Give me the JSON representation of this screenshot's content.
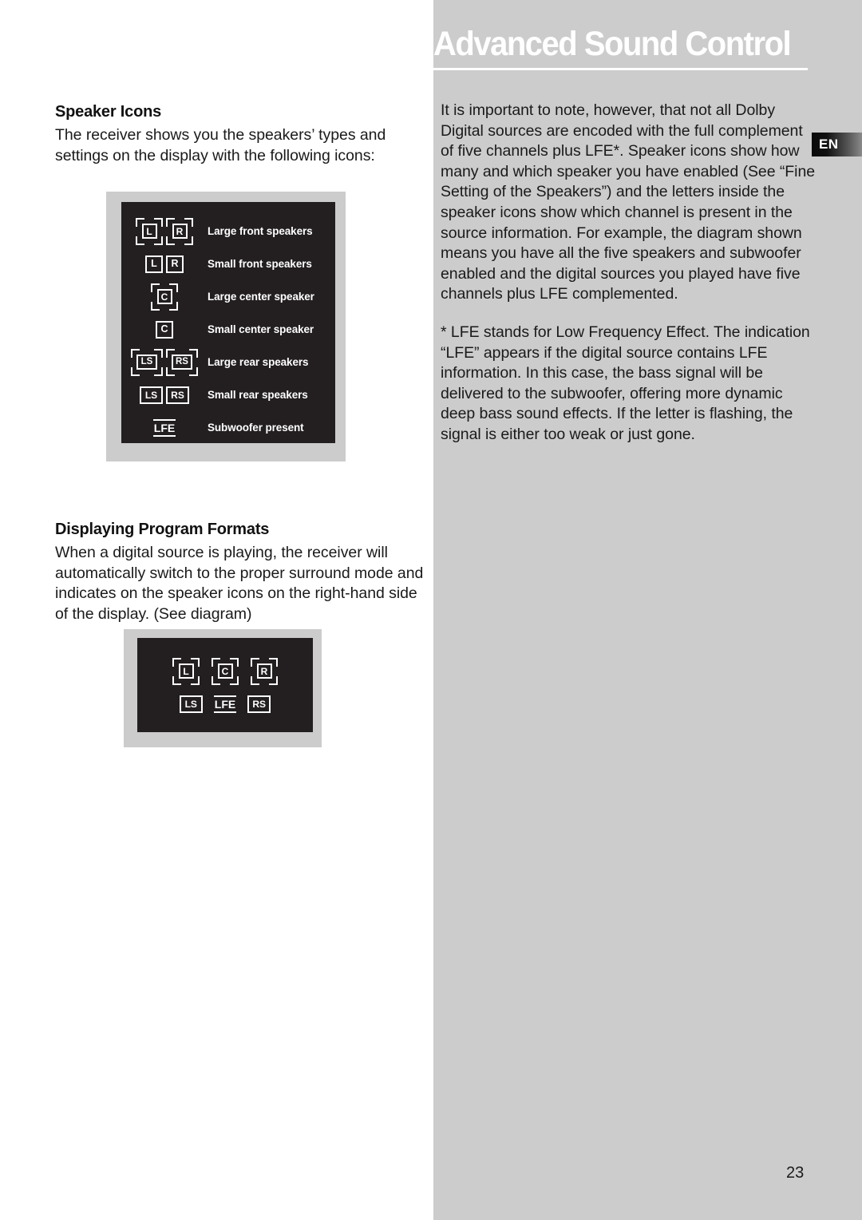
{
  "document": {
    "title": "Advanced Sound Control",
    "language_badge": "EN",
    "page_number": "23"
  },
  "left_column": {
    "sections": [
      {
        "heading": "Speaker Icons",
        "paragraph": "The receiver shows you the speakers’ types and settings on the display with the following icons:"
      },
      {
        "heading": "Displaying Program Formats",
        "paragraph": "When a digital source is playing, the receiver will automatically switch to the proper surround mode and indicates on the speaker icons on the right-hand side of the display. (See diagram)"
      }
    ]
  },
  "right_column": {
    "paragraphs": [
      "It is important to note, however, that not all Dolby Digital sources are encoded with the full complement of five channels plus LFE*. Speaker icons show how many and which speaker you have enabled (See “Fine Setting of the Speakers”) and the letters inside the speaker icons show which channel is present in the source information. For example, the diagram shown means you have all the five speakers and subwoofer enabled and the digital sources you played have five channels plus LFE complemented.",
      "* LFE stands for Low Frequency Effect. The indication “LFE” appears if the digital source contains LFE information. In this case, the bass signal will be delivered to the subwoofer, offering more dynamic deep bass sound effects. If the letter is flashing, the signal is either too weak or just gone."
    ]
  },
  "speaker_icon_legend": {
    "rows": [
      {
        "icons": [
          "L",
          "R"
        ],
        "size": "large",
        "label": "Large front speakers"
      },
      {
        "icons": [
          "L",
          "R"
        ],
        "size": "small",
        "label": "Small front speakers"
      },
      {
        "icons": [
          "C"
        ],
        "size": "large",
        "label": "Large center speaker"
      },
      {
        "icons": [
          "C"
        ],
        "size": "small",
        "label": "Small center speaker"
      },
      {
        "icons": [
          "LS",
          "RS"
        ],
        "size": "large",
        "label": "Large rear speakers"
      },
      {
        "icons": [
          "LS",
          "RS"
        ],
        "size": "small",
        "label": "Small rear speakers"
      },
      {
        "icons": [
          "LFE"
        ],
        "size": "lfe",
        "label": "Subwoofer present"
      }
    ],
    "labels": {
      "large_front": "Large front speakers",
      "small_front": "Small front speakers",
      "large_center": "Large center speaker",
      "small_center": "Small center speaker",
      "large_rear": "Large rear speakers",
      "small_rear": "Small rear speakers",
      "subwoofer": "Subwoofer present"
    },
    "glyphs": {
      "l": "L",
      "r": "R",
      "c": "C",
      "ls": "LS",
      "rs": "RS",
      "lfe": "LFE"
    },
    "colors": {
      "panel_background": "#231f20",
      "panel_border": "#cccccc",
      "icon_stroke": "#ffffff",
      "label_text": "#ffffff"
    }
  },
  "program_format_display": {
    "top_row": [
      "L",
      "C",
      "R"
    ],
    "bottom_row": [
      "LS",
      "LFE",
      "RS"
    ],
    "top_row_size": "large",
    "bottom_row_size": "small"
  }
}
